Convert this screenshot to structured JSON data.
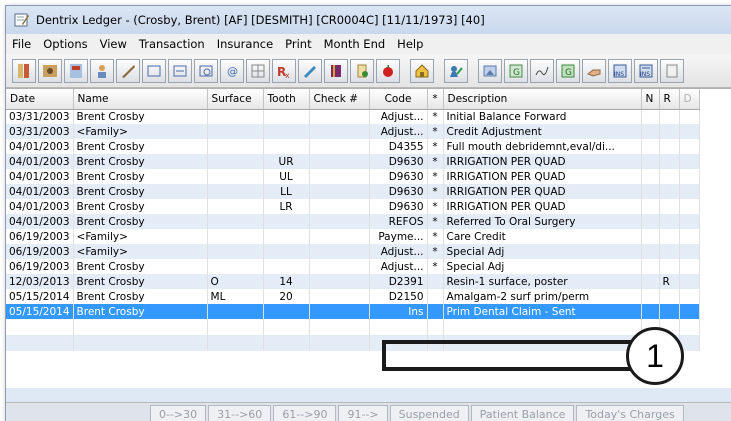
{
  "window": {
    "title": "Dentrix Ledger - (Crosby, Brent) [AF] [DESMITH] [CR0004C] [11/11/1973] [40]"
  },
  "menu": [
    "File",
    "Options",
    "View",
    "Transaction",
    "Insurance",
    "Print",
    "Month End",
    "Help"
  ],
  "toolbar_icons": [
    "tooth-chart-icon",
    "family-file-icon",
    "patient-chart-icon",
    "perio-icon",
    "treatment-planner-icon",
    "ledger-icon",
    "office-journal-icon",
    "continuing-care-icon",
    "email-icon",
    "doc-center-icon",
    "rx-icon",
    "quick-labels-icon",
    "book-icon",
    "document-icon",
    "apple-icon",
    "home-icon",
    "patient-icon",
    "image-icon",
    "g-icon",
    "sign-icon",
    "g2-icon",
    "hands-icon",
    "ins-icon",
    "ins2-icon",
    "notes-icon"
  ],
  "ledger": {
    "columns": [
      "Date",
      "Name",
      "Surface",
      "Tooth",
      "Check #",
      "Code",
      "*",
      "Description",
      "N",
      "R",
      "D"
    ],
    "rows": [
      {
        "date": "03/31/2003",
        "name": "Brent Crosby",
        "surface": "",
        "tooth": "",
        "check": "",
        "code": "Adjust...",
        "star": "*",
        "desc": "Initial Balance Forward",
        "n": "",
        "r": ""
      },
      {
        "date": "03/31/2003",
        "name": "<Family>",
        "surface": "",
        "tooth": "",
        "check": "",
        "code": "Adjust...",
        "star": "*",
        "desc": "Credit Adjustment",
        "n": "",
        "r": ""
      },
      {
        "date": "04/01/2003",
        "name": "Brent Crosby",
        "surface": "",
        "tooth": "",
        "check": "",
        "code": "D4355",
        "star": "*",
        "desc": "Full mouth debridemnt,eval/di...",
        "n": "",
        "r": ""
      },
      {
        "date": "04/01/2003",
        "name": "Brent Crosby",
        "surface": "",
        "tooth": "UR",
        "check": "",
        "code": "D9630",
        "star": "*",
        "desc": "IRRIGATION PER QUAD",
        "n": "",
        "r": ""
      },
      {
        "date": "04/01/2003",
        "name": "Brent Crosby",
        "surface": "",
        "tooth": "UL",
        "check": "",
        "code": "D9630",
        "star": "*",
        "desc": "IRRIGATION PER QUAD",
        "n": "",
        "r": ""
      },
      {
        "date": "04/01/2003",
        "name": "Brent Crosby",
        "surface": "",
        "tooth": "LL",
        "check": "",
        "code": "D9630",
        "star": "*",
        "desc": "IRRIGATION PER QUAD",
        "n": "",
        "r": ""
      },
      {
        "date": "04/01/2003",
        "name": "Brent Crosby",
        "surface": "",
        "tooth": "LR",
        "check": "",
        "code": "D9630",
        "star": "*",
        "desc": "IRRIGATION PER QUAD",
        "n": "",
        "r": ""
      },
      {
        "date": "04/01/2003",
        "name": "Brent Crosby",
        "surface": "",
        "tooth": "",
        "check": "",
        "code": "REFOS",
        "star": "*",
        "desc": "Referred To Oral Surgery",
        "n": "",
        "r": ""
      },
      {
        "date": "06/19/2003",
        "name": "<Family>",
        "surface": "",
        "tooth": "",
        "check": "",
        "code": "Payme...",
        "star": "*",
        "desc": "Care Credit",
        "n": "",
        "r": ""
      },
      {
        "date": "06/19/2003",
        "name": "<Family>",
        "surface": "",
        "tooth": "",
        "check": "",
        "code": "Adjust...",
        "star": "*",
        "desc": "Special Adj",
        "n": "",
        "r": ""
      },
      {
        "date": "06/19/2003",
        "name": "Brent Crosby",
        "surface": "",
        "tooth": "",
        "check": "",
        "code": "Adjust...",
        "star": "*",
        "desc": "Special Adj",
        "n": "",
        "r": ""
      },
      {
        "date": "12/03/2013",
        "name": "Brent Crosby",
        "surface": "O",
        "tooth": "14",
        "check": "",
        "code": "D2391",
        "star": "",
        "desc": "Resin-1 surface, poster",
        "n": "",
        "r": "R"
      },
      {
        "date": "05/15/2014",
        "name": "Brent Crosby",
        "surface": "ML",
        "tooth": "20",
        "check": "",
        "code": "D2150",
        "star": "",
        "desc": "Amalgam-2 surf prim/perm",
        "n": "",
        "r": ""
      },
      {
        "date": "05/15/2014",
        "name": "Brent Crosby",
        "surface": "",
        "tooth": "",
        "check": "",
        "code": "Ins",
        "star": "",
        "desc": "Prim Dental Claim - Sent",
        "n": "",
        "r": ""
      }
    ]
  },
  "status_buttons": [
    "0-->30",
    "31-->60",
    "61-->90",
    "91-->",
    "Suspended",
    "Patient Balance",
    "Today's Charges"
  ],
  "callout": {
    "number": "1"
  },
  "colors": {
    "selected_row": "#3399ff",
    "alt_row": "#e4ecf8",
    "window_frame": "#dfe8f5"
  }
}
